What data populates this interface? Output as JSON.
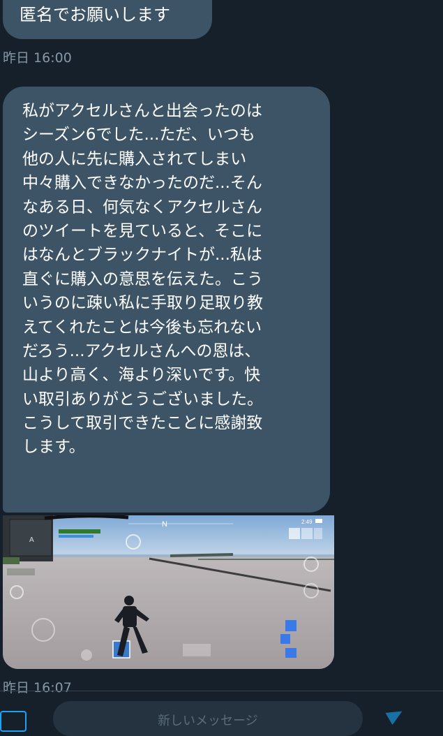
{
  "messages": [
    {
      "text": "匿名でお願いします",
      "timestamp": "昨日 16:00"
    },
    {
      "lines": [
        "私がアクセルさんと出会ったのは",
        "シーズン6でした...ただ、いつも",
        "他の人に先に購入されてしまい",
        "中々購入できなかったのだ...そん",
        "なある日、何気なくアクセルさん",
        "のツイートを見ていると、そこに",
        "はなんとブラックナイトが...私は",
        "直ぐに購入の意思を伝えた。こう",
        "いうのに疎い私に手取り足取り教",
        "えてくれたことは今後も忘れない",
        "だろう...アクセルさんへの恩は、",
        "山より高く、海より深いです。快",
        "い取引ありがとうございました。",
        "こうして取引できたことに感謝致",
        "します。"
      ]
    },
    {
      "image": "game-screenshot",
      "timestamp": "昨日 16:07"
    }
  ],
  "game_hud": {
    "compass_letter": "N",
    "minimap_marker": "A",
    "time": "2:49"
  },
  "composer": {
    "placeholder": "新しいメッセージ"
  },
  "icons": {
    "left": "media-icon",
    "right": "send-icon"
  },
  "colors": {
    "background": "#15202b",
    "bubble": "#3d5466",
    "timestamp": "#8899a6",
    "accent": "#1da1f2"
  }
}
